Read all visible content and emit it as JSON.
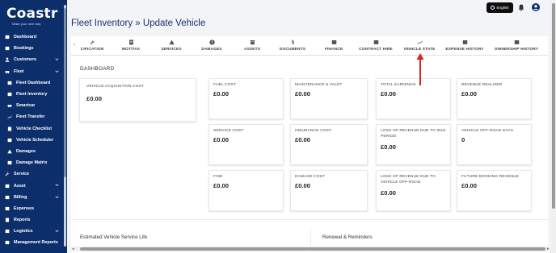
{
  "brand": {
    "name": "Coastr",
    "tagline": "Make your own way"
  },
  "sidebar": {
    "items": [
      {
        "label": "Dashboard",
        "icon": "dashboard-icon",
        "chevron": false,
        "sub": false
      },
      {
        "label": "Bookings",
        "icon": "bookings-icon",
        "chevron": false,
        "sub": false
      },
      {
        "label": "Customers",
        "icon": "customers-icon",
        "chevron": true,
        "sub": false
      },
      {
        "label": "Fleet",
        "icon": "fleet-icon",
        "chevron": true,
        "sub": false
      },
      {
        "label": "Fleet Dashboard",
        "icon": "fleet-dashboard-icon",
        "chevron": false,
        "sub": true
      },
      {
        "label": "Fleet Inventory",
        "icon": "fleet-inventory-icon",
        "chevron": false,
        "sub": true
      },
      {
        "label": "Smartcar",
        "icon": "smartcar-icon",
        "chevron": false,
        "sub": true
      },
      {
        "label": "Fleet Transfer",
        "icon": "fleet-transfer-icon",
        "chevron": false,
        "sub": true
      },
      {
        "label": "Vehicle Checklist",
        "icon": "vehicle-checklist-icon",
        "chevron": false,
        "sub": true
      },
      {
        "label": "Vehicle Scheduler",
        "icon": "vehicle-scheduler-icon",
        "chevron": false,
        "sub": true
      },
      {
        "label": "Damages",
        "icon": "damages-icon",
        "chevron": false,
        "sub": true
      },
      {
        "label": "Damage Matrix",
        "icon": "damage-matrix-icon",
        "chevron": false,
        "sub": true
      },
      {
        "label": "Service",
        "icon": "service-icon",
        "chevron": false,
        "sub": false
      },
      {
        "label": "Asset",
        "icon": "asset-icon",
        "chevron": true,
        "sub": false
      },
      {
        "label": "Billing",
        "icon": "billing-icon",
        "chevron": true,
        "sub": false
      },
      {
        "label": "Expenses",
        "icon": "expenses-icon",
        "chevron": false,
        "sub": false
      },
      {
        "label": "Reports",
        "icon": "reports-icon",
        "chevron": false,
        "sub": false
      },
      {
        "label": "Logistics",
        "icon": "logistics-icon",
        "chevron": true,
        "sub": false
      },
      {
        "label": "Management Reports",
        "icon": "management-reports-icon",
        "chevron": false,
        "sub": false
      }
    ]
  },
  "header": {
    "breadcrumb_parent": "Fleet Inventory",
    "breadcrumb_sep": "»",
    "breadcrumb_current": "Update Vehicle",
    "language": "English"
  },
  "tabs": [
    {
      "label": "CIFICATION",
      "icon": "wrench-icon"
    },
    {
      "label": "MOT/TAX",
      "icon": "document-icon"
    },
    {
      "label": "SERVICES",
      "icon": "warning-icon"
    },
    {
      "label": "DAMAGES",
      "icon": "alert-circle-icon"
    },
    {
      "label": "ASSETS",
      "icon": "archive-icon"
    },
    {
      "label": "DOCUMENTS",
      "icon": "paperclip-icon"
    },
    {
      "label": "FINANCE",
      "icon": "finance-icon"
    },
    {
      "label": "CONTRACT HIRE",
      "icon": "contract-icon"
    },
    {
      "label": "VEHICLE STATE",
      "icon": "vehicle-state-icon"
    },
    {
      "label": "EXPENSE HISTORY",
      "icon": "expense-history-icon"
    },
    {
      "label": "OWNERSHIP HISTORY",
      "icon": "ownership-history-icon"
    }
  ],
  "dashboard": {
    "title": "DASHBOARD",
    "acquisition": {
      "label": "VEHICLE ACQUISITION COST",
      "value": "£0.00"
    },
    "cards": [
      {
        "label": "FUEL COST",
        "value": "£0.00"
      },
      {
        "label": "MAINTENANCE & VALET",
        "value": "£0.00"
      },
      {
        "label": "TOTAL EARNINGS",
        "value": "£0.00"
      },
      {
        "label": "REVENUE REALIZED",
        "value": "£0.00"
      },
      {
        "label": "SERVICE COST",
        "value": "£0.00"
      },
      {
        "label": "INSURANCE COST",
        "value": "£0.00"
      },
      {
        "label": "LOSS OF REVENUE DUE TO IDLE PERIOD",
        "value": "£0.00"
      },
      {
        "label": "VEHICLE OFF-ROAD DAYS",
        "value": "0"
      },
      {
        "label": "FINE",
        "value": "£0.00"
      },
      {
        "label": "DAMAGE COST",
        "value": "£0.00"
      },
      {
        "label": "LOSS OF REVENUE DUE TO VEHICLE OFF-ROAD",
        "value": "£0.00"
      },
      {
        "label": "FUTURE BOOKING REVENUE",
        "value": "£0.00"
      }
    ]
  },
  "sections": {
    "left": "Estimated Vehicle Service Life",
    "right": "Renewal & Reminders"
  },
  "colors": {
    "sidebar": "#0c2f6b",
    "title": "#17336b",
    "annotation": "#e01e1e"
  }
}
